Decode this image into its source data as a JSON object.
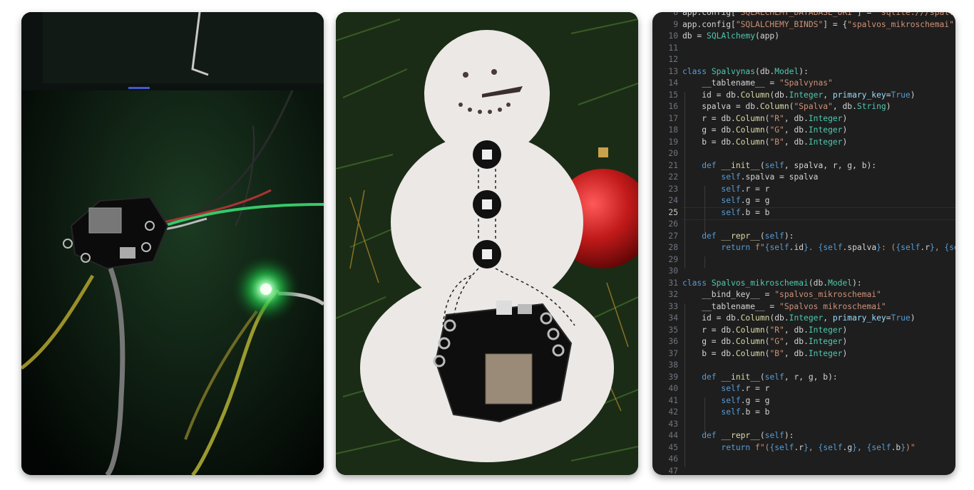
{
  "panels": {
    "left": {
      "subject": "microcontroller-board-with-green-led"
    },
    "middle": {
      "subject": "felt-snowman-ornament-with-leds"
    },
    "right": {
      "subject": "python-code-editor"
    }
  },
  "code": {
    "current_line": 25,
    "lines": [
      {
        "n": 8,
        "tokens": [
          [
            "app.config[",
            "txt"
          ],
          [
            "\"SQLALCHEMY_DATABASE_URI\"",
            "str"
          ],
          [
            "] = ",
            "txt"
          ],
          [
            "\"sqlite:///spalvo",
            "str"
          ]
        ]
      },
      {
        "n": 9,
        "tokens": [
          [
            "app.config[",
            "txt"
          ],
          [
            "\"SQLALCHEMY_BINDS\"",
            "str"
          ],
          [
            "] = {",
            "txt"
          ],
          [
            "\"spalvos_mikroschemai\"",
            "str"
          ],
          [
            ":",
            "txt"
          ]
        ]
      },
      {
        "n": 10,
        "tokens": [
          [
            "db = ",
            "txt"
          ],
          [
            "SQLAlchemy",
            "cls"
          ],
          [
            "(app)",
            "txt"
          ]
        ]
      },
      {
        "n": 11,
        "tokens": []
      },
      {
        "n": 12,
        "tokens": []
      },
      {
        "n": 13,
        "tokens": [
          [
            "class ",
            "kw"
          ],
          [
            "Spalvynas",
            "cls"
          ],
          [
            "(db.",
            "txt"
          ],
          [
            "Model",
            "cls"
          ],
          [
            "):",
            "txt"
          ]
        ]
      },
      {
        "n": 14,
        "tokens": [
          [
            "    __tablename__ = ",
            "txt"
          ],
          [
            "\"Spalvynas\"",
            "str"
          ]
        ]
      },
      {
        "n": 15,
        "tokens": [
          [
            "    id = db.",
            "txt"
          ],
          [
            "Column",
            "fn"
          ],
          [
            "(db.",
            "txt"
          ],
          [
            "Integer",
            "cls"
          ],
          [
            ", ",
            "txt"
          ],
          [
            "primary_key",
            "var"
          ],
          [
            "=",
            "txt"
          ],
          [
            "True",
            "bool"
          ],
          [
            ")",
            "txt"
          ]
        ]
      },
      {
        "n": 16,
        "tokens": [
          [
            "    spalva = db.",
            "txt"
          ],
          [
            "Column",
            "fn"
          ],
          [
            "(",
            "txt"
          ],
          [
            "\"Spalva\"",
            "str"
          ],
          [
            ", db.",
            "txt"
          ],
          [
            "String",
            "cls"
          ],
          [
            ")",
            "txt"
          ]
        ]
      },
      {
        "n": 17,
        "tokens": [
          [
            "    r = db.",
            "txt"
          ],
          [
            "Column",
            "fn"
          ],
          [
            "(",
            "txt"
          ],
          [
            "\"R\"",
            "str"
          ],
          [
            ", db.",
            "txt"
          ],
          [
            "Integer",
            "cls"
          ],
          [
            ")",
            "txt"
          ]
        ]
      },
      {
        "n": 18,
        "tokens": [
          [
            "    g = db.",
            "txt"
          ],
          [
            "Column",
            "fn"
          ],
          [
            "(",
            "txt"
          ],
          [
            "\"G\"",
            "str"
          ],
          [
            ", db.",
            "txt"
          ],
          [
            "Integer",
            "cls"
          ],
          [
            ")",
            "txt"
          ]
        ]
      },
      {
        "n": 19,
        "tokens": [
          [
            "    b = db.",
            "txt"
          ],
          [
            "Column",
            "fn"
          ],
          [
            "(",
            "txt"
          ],
          [
            "\"B\"",
            "str"
          ],
          [
            ", db.",
            "txt"
          ],
          [
            "Integer",
            "cls"
          ],
          [
            ")",
            "txt"
          ]
        ]
      },
      {
        "n": 20,
        "tokens": []
      },
      {
        "n": 21,
        "tokens": [
          [
            "    def ",
            "kw"
          ],
          [
            "__init__",
            "fn"
          ],
          [
            "(",
            "txt"
          ],
          [
            "self",
            "self"
          ],
          [
            ", spalva, r, g, b):",
            "txt"
          ]
        ]
      },
      {
        "n": 22,
        "tokens": [
          [
            "        ",
            "txt"
          ],
          [
            "self",
            "self"
          ],
          [
            ".spalva = spalva",
            "txt"
          ]
        ]
      },
      {
        "n": 23,
        "tokens": [
          [
            "        ",
            "txt"
          ],
          [
            "self",
            "self"
          ],
          [
            ".r = r",
            "txt"
          ]
        ]
      },
      {
        "n": 24,
        "tokens": [
          [
            "        ",
            "txt"
          ],
          [
            "self",
            "self"
          ],
          [
            ".g = g",
            "txt"
          ]
        ]
      },
      {
        "n": 25,
        "tokens": [
          [
            "        ",
            "txt"
          ],
          [
            "self",
            "self"
          ],
          [
            ".b = b",
            "txt"
          ]
        ]
      },
      {
        "n": 26,
        "tokens": []
      },
      {
        "n": 27,
        "tokens": [
          [
            "    def ",
            "kw"
          ],
          [
            "__repr__",
            "fn"
          ],
          [
            "(",
            "txt"
          ],
          [
            "self",
            "self"
          ],
          [
            "):",
            "txt"
          ]
        ]
      },
      {
        "n": 28,
        "tokens": [
          [
            "        ",
            "txt"
          ],
          [
            "return ",
            "kw"
          ],
          [
            "f\"",
            "str"
          ],
          [
            "{",
            "kw"
          ],
          [
            "self",
            "self"
          ],
          [
            ".id",
            "txt"
          ],
          [
            "}",
            "kw"
          ],
          [
            ". ",
            "str"
          ],
          [
            "{",
            "kw"
          ],
          [
            "self",
            "self"
          ],
          [
            ".spalva",
            "txt"
          ],
          [
            "}",
            "kw"
          ],
          [
            ": (",
            "str"
          ],
          [
            "{",
            "kw"
          ],
          [
            "self",
            "self"
          ],
          [
            ".r",
            "txt"
          ],
          [
            "}",
            "kw"
          ],
          [
            ", ",
            "str"
          ],
          [
            "{se",
            "kw"
          ]
        ]
      },
      {
        "n": 29,
        "tokens": []
      },
      {
        "n": 30,
        "tokens": []
      },
      {
        "n": 31,
        "tokens": [
          [
            "class ",
            "kw"
          ],
          [
            "Spalvos_mikroschemai",
            "cls"
          ],
          [
            "(db.",
            "txt"
          ],
          [
            "Model",
            "cls"
          ],
          [
            "):",
            "txt"
          ]
        ]
      },
      {
        "n": 32,
        "tokens": [
          [
            "    __bind_key__ = ",
            "txt"
          ],
          [
            "\"spalvos_mikroschemai\"",
            "str"
          ]
        ]
      },
      {
        "n": 33,
        "tokens": [
          [
            "    __tablename__ = ",
            "txt"
          ],
          [
            "\"Spalvos mikroschemai\"",
            "str"
          ]
        ]
      },
      {
        "n": 34,
        "tokens": [
          [
            "    id = db.",
            "txt"
          ],
          [
            "Column",
            "fn"
          ],
          [
            "(db.",
            "txt"
          ],
          [
            "Integer",
            "cls"
          ],
          [
            ", ",
            "txt"
          ],
          [
            "primary_key",
            "var"
          ],
          [
            "=",
            "txt"
          ],
          [
            "True",
            "bool"
          ],
          [
            ")",
            "txt"
          ]
        ]
      },
      {
        "n": 35,
        "tokens": [
          [
            "    r = db.",
            "txt"
          ],
          [
            "Column",
            "fn"
          ],
          [
            "(",
            "txt"
          ],
          [
            "\"R\"",
            "str"
          ],
          [
            ", db.",
            "txt"
          ],
          [
            "Integer",
            "cls"
          ],
          [
            ")",
            "txt"
          ]
        ]
      },
      {
        "n": 36,
        "tokens": [
          [
            "    g = db.",
            "txt"
          ],
          [
            "Column",
            "fn"
          ],
          [
            "(",
            "txt"
          ],
          [
            "\"G\"",
            "str"
          ],
          [
            ", db.",
            "txt"
          ],
          [
            "Integer",
            "cls"
          ],
          [
            ")",
            "txt"
          ]
        ]
      },
      {
        "n": 37,
        "tokens": [
          [
            "    b = db.",
            "txt"
          ],
          [
            "Column",
            "fn"
          ],
          [
            "(",
            "txt"
          ],
          [
            "\"B\"",
            "str"
          ],
          [
            ", db.",
            "txt"
          ],
          [
            "Integer",
            "cls"
          ],
          [
            ")",
            "txt"
          ]
        ]
      },
      {
        "n": 38,
        "tokens": []
      },
      {
        "n": 39,
        "tokens": [
          [
            "    def ",
            "kw"
          ],
          [
            "__init__",
            "fn"
          ],
          [
            "(",
            "txt"
          ],
          [
            "self",
            "self"
          ],
          [
            ", r, g, b):",
            "txt"
          ]
        ]
      },
      {
        "n": 40,
        "tokens": [
          [
            "        ",
            "txt"
          ],
          [
            "self",
            "self"
          ],
          [
            ".r = r",
            "txt"
          ]
        ]
      },
      {
        "n": 41,
        "tokens": [
          [
            "        ",
            "txt"
          ],
          [
            "self",
            "self"
          ],
          [
            ".g = g",
            "txt"
          ]
        ]
      },
      {
        "n": 42,
        "tokens": [
          [
            "        ",
            "txt"
          ],
          [
            "self",
            "self"
          ],
          [
            ".b = b",
            "txt"
          ]
        ]
      },
      {
        "n": 43,
        "tokens": []
      },
      {
        "n": 44,
        "tokens": [
          [
            "    def ",
            "kw"
          ],
          [
            "__repr__",
            "fn"
          ],
          [
            "(",
            "txt"
          ],
          [
            "self",
            "self"
          ],
          [
            "):",
            "txt"
          ]
        ]
      },
      {
        "n": 45,
        "tokens": [
          [
            "        ",
            "txt"
          ],
          [
            "return ",
            "kw"
          ],
          [
            "f\"(",
            "str"
          ],
          [
            "{",
            "kw"
          ],
          [
            "self",
            "self"
          ],
          [
            ".r",
            "txt"
          ],
          [
            "}",
            "kw"
          ],
          [
            ", ",
            "str"
          ],
          [
            "{",
            "kw"
          ],
          [
            "self",
            "self"
          ],
          [
            ".g",
            "txt"
          ],
          [
            "}",
            "kw"
          ],
          [
            ", ",
            "str"
          ],
          [
            "{",
            "kw"
          ],
          [
            "self",
            "self"
          ],
          [
            ".b",
            "txt"
          ],
          [
            "}",
            "kw"
          ],
          [
            ")\"",
            "str"
          ]
        ]
      },
      {
        "n": 46,
        "tokens": []
      },
      {
        "n": 47,
        "tokens": []
      }
    ]
  }
}
